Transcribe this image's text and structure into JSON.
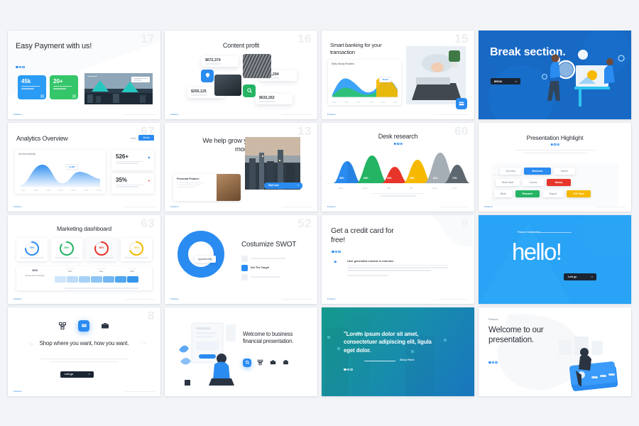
{
  "meta": {
    "background_color": "#f2f4f7",
    "accent_blue": "#2a8bf0",
    "brand": "Finance"
  },
  "slides": [
    {
      "id": "easy-payment",
      "number": "17",
      "title": "Easy Payment with us!",
      "stats": [
        {
          "value": "45k",
          "caption": "Successful payments",
          "color": "#2a9cf5"
        },
        {
          "value": "20+",
          "caption": "Available in country",
          "color": "#35c66a"
        }
      ],
      "photo_caption": "New Dimension Daily",
      "brand": "Finance"
    },
    {
      "id": "content-profit",
      "number": "16",
      "title": "Content profit",
      "amounts": [
        {
          "value": "$672,374",
          "unit": "M",
          "caption": "Content profit"
        },
        {
          "value": "$285,294",
          "unit": "M",
          "caption": "Content profit"
        },
        {
          "value": "$255,125",
          "unit": "M",
          "caption": "Content profit"
        },
        {
          "value": "$632,262",
          "unit": "M",
          "caption": "Content profit"
        }
      ],
      "icons": [
        "lightbulb-icon",
        "search-icon"
      ],
      "brand": "Finance"
    },
    {
      "id": "smart-banking",
      "number": "15",
      "title": "Smart banking for your transaction",
      "chart_label": "Daily Study Routine",
      "chart_tooltip": "68,313",
      "icon": "card-icon",
      "brand": "Finance"
    },
    {
      "id": "break-section",
      "number": "",
      "title": "Break section.",
      "button_label": "BREAK",
      "brand": ""
    },
    {
      "id": "analytics-overview",
      "number": "67",
      "title": "Analytics Overview",
      "panel_label": "Current Activity",
      "tooltip": "13,980",
      "tabs": [
        "Week",
        "Month"
      ],
      "stats": [
        {
          "value": "526+",
          "caption": "Lorem ipsum dolor sit amet consectetuer adipiscing",
          "arrow": "up"
        },
        {
          "value": "35%",
          "caption": "Lorem ipsum dolor sit amet consectetuer adipiscing",
          "arrow": "down"
        }
      ],
      "brand": "Finance"
    },
    {
      "id": "grow-money",
      "number": "13",
      "title": "We help grow your money!",
      "card_title": "Personal Finance",
      "card_body": "Lorem ipsum dolor sit amet consectetuer adipiscing elit sed diam",
      "button_label": "Start now",
      "brand": "Finance"
    },
    {
      "id": "desk-research",
      "number": "60",
      "title": "Desk research",
      "footer": "Lorem ipsum dolor sit amet consectetuer adipiscing elit sed diam nonummy nibh euismod tincidunt ut laoreet",
      "brand": "Finance",
      "chart_data": {
        "type": "area",
        "title": "Desk research",
        "categories": [
          "Data",
          "Work",
          "Plan",
          "Info",
          "Goal",
          "Team"
        ],
        "values": [
          55,
          65,
          35,
          55,
          82,
          70
        ],
        "labels": [
          "55%",
          "65%",
          "35%",
          "55%",
          "82%",
          "70%"
        ],
        "colors": [
          "#2a8bf0",
          "#24b463",
          "#e8352b",
          "#f6b900",
          "#a5adb5",
          "#5d6770"
        ],
        "ylabel": "",
        "xlabel": "",
        "ylim": [
          0,
          100
        ],
        "grid": false,
        "legend": "none"
      }
    },
    {
      "id": "presentation-highlight",
      "number": "",
      "title": "Presentation Highlight",
      "subtitle": "Lorem ipsum dolor sit amet consectetuer adipiscing elit sed diam nonummy nibh euismod tincidunt ut laoreet dolore magna aliquam erat volutpat",
      "tags": [
        {
          "label": "Our Idea",
          "color": "#ffffff",
          "text": "#9aa3ad"
        },
        {
          "label": "Business",
          "color": "#2a8bf0",
          "text": "#ffffff"
        },
        {
          "label": "Notice",
          "color": "#ffffff",
          "text": "#9aa3ad"
        },
        {
          "label": "Work Hard",
          "color": "#ffffff",
          "text": "#9aa3ad"
        },
        {
          "label": "Course",
          "color": "#ffffff",
          "text": "#9aa3ad"
        },
        {
          "label": "Money",
          "color": "#e8352b",
          "text": "#ffffff"
        },
        {
          "label": "Work",
          "color": "#ffffff",
          "text": "#9aa3ad"
        },
        {
          "label": "Research",
          "color": "#24b463",
          "text": "#ffffff"
        },
        {
          "label": "Report",
          "color": "#ffffff",
          "text": "#9aa3ad"
        },
        {
          "label": "Full Team",
          "color": "#f6b900",
          "text": "#ffffff"
        }
      ],
      "brand": "Finance"
    },
    {
      "id": "marketing-dashboard",
      "number": "63",
      "title": "Marketing dashboard",
      "brand": "Finance",
      "chart_data": {
        "type": "pie",
        "title": "Marketing dashboard",
        "categories": [
          "Marketing",
          "Sales",
          "Revenue",
          "Growth"
        ],
        "values": [
          75,
          86,
          80,
          70
        ],
        "labels": [
          "75%",
          "86%",
          "80%",
          "70%"
        ],
        "colors": [
          "#2a8bf0",
          "#24b463",
          "#e8352b",
          "#f6b900"
        ],
        "captions": [
          "Lorem ipsum dolor sit amet",
          "Lorem ipsum dolor sit amet",
          "Lorem ipsum dolor sit amet",
          "Lorem ipsum dolor sit amet"
        ]
      },
      "progress": {
        "label": "Timing and Progress",
        "value": "2019",
        "steps": [
          {
            "label": "Lorem Ipsum",
            "value": "50%"
          },
          {
            "label": "Lorem Ipsum",
            "value": "40%"
          },
          {
            "label": "Lorem Ipsum",
            "value": "35%"
          }
        ],
        "footer": "Lorem ipsum dolor sit amet consectetuer adipiscing elit sed diam nonummy"
      }
    },
    {
      "id": "costumize-swot",
      "number": "52",
      "title": "Costumize SWOT",
      "letter": "O",
      "letter_label": "opportunity",
      "items": [
        {
          "label": "Your Business Overview",
          "active": false
        },
        {
          "label": "Set The Target",
          "active": true
        },
        {
          "label": "Lorem Ipsum Dolor",
          "active": false
        }
      ],
      "brand": "Finance"
    },
    {
      "id": "credit-card-free",
      "number": "9",
      "title": "Get a credit card for free!",
      "bullet_title": "User generated content in real-time",
      "bullet_body": "Lorem ipsum dolor sit amet consectetuer adipiscing elit sed diam nonummy nibh euismod tincidunt ut laoreet dolore magna aliquam erat volutpat ut wisi enim ad minim veniam quis nostrud",
      "bullet_note": "Lorem ipsum dolor sit amet consectetuer",
      "brand": "Finance"
    },
    {
      "id": "hello",
      "number": "",
      "kicker": "Finance Introduction",
      "title": "hello!",
      "button_label": "Let's go",
      "brand": ""
    },
    {
      "id": "shop-where-you-want",
      "number": "8",
      "title": "Shop where you want, how you want.",
      "body": "Lorem ipsum dolor sit amet consectetuer adipiscing elit sed diam nonummy nibh euismod tincidunt ut laoreet dolore",
      "button_label": "Let's go",
      "icons": [
        "network-icon",
        "hand-card-icon",
        "briefcase-icon"
      ],
      "brand": "Finance"
    },
    {
      "id": "welcome-business",
      "number": "",
      "title": "Welcome to business financial presentation.",
      "icons": [
        "search-icon",
        "network-icon",
        "briefcase-icon",
        "case-icon"
      ],
      "brand": ""
    },
    {
      "id": "quote",
      "number": "",
      "quote": "\"Lorem ipsum dolor sit amet, consectetuer adipiscing elit, ligula eget dolor.",
      "attribution": "Sticky Fibert",
      "brand": ""
    },
    {
      "id": "welcome-our-presentation",
      "number": "",
      "kicker": "Finance",
      "title": "Welcome to our presentation.",
      "brand": ""
    }
  ]
}
